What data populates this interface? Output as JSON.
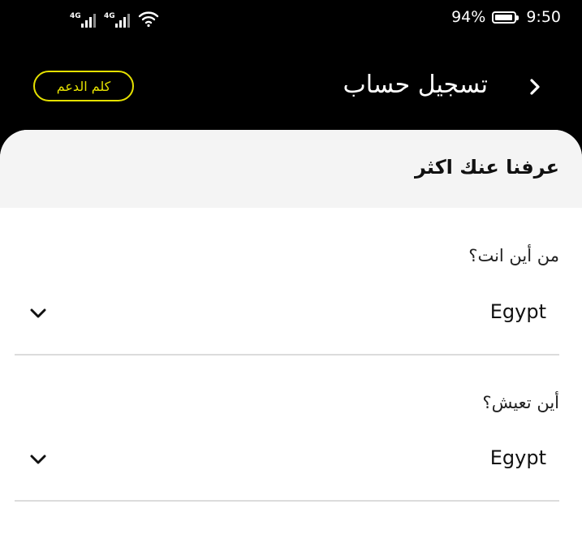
{
  "status_bar": {
    "sim1_network": "4G",
    "sim2_network": "4G",
    "battery": "94%",
    "battery_level": 0.94,
    "time": "9:50"
  },
  "header": {
    "title": "تسجيل حساب",
    "support_label": "كلم الدعم",
    "accent_color": "#e5e100",
    "back_icon": "chevron-right-icon"
  },
  "section": {
    "title": "عرفنا عنك اكثر"
  },
  "form": {
    "fields": [
      {
        "label": "من أين انت؟",
        "value": "Egypt",
        "icon": "chevron-down-icon"
      },
      {
        "label": "أين تعيش؟",
        "value": "Egypt",
        "icon": "chevron-down-icon"
      }
    ]
  }
}
